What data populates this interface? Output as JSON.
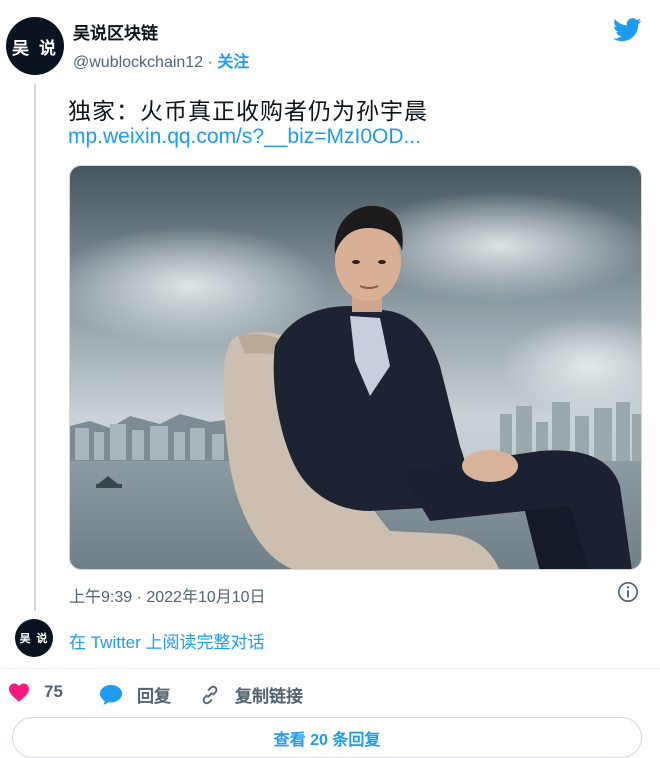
{
  "author": {
    "name": "吴说区块链",
    "handle": "@wublockchain12",
    "separator": " · ",
    "follow_label": "关注",
    "avatar_text": "吴 说"
  },
  "tweet": {
    "text": "独家：火币真正收购者仍为孙宇晨",
    "link": "mp.weixin.qq.com/s?__biz=MzI0OD...",
    "timestamp": "上午9:39 · 2022年10月10日"
  },
  "thread": {
    "avatar_text": "吴 说",
    "read_label": "在 Twitter 上阅读完整对话"
  },
  "actions": {
    "like_count": "75",
    "reply_label": "回复",
    "copy_label": "复制链接"
  },
  "replies_button": "查看 20 条回复",
  "icons": {
    "bird": "twitter-bird-icon",
    "info": "info-icon",
    "heart": "heart-icon",
    "reply": "reply-bubble-icon",
    "link": "link-icon"
  },
  "colors": {
    "accent": "#1d9bf0",
    "like": "#f91880",
    "text": "#0f1419",
    "muted": "#536471"
  }
}
